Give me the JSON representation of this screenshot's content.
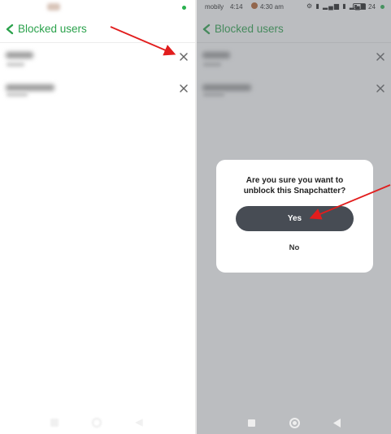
{
  "colors": {
    "accent": "#2ba24c",
    "arrow": "#e21d1d",
    "yes_button": "#474c54",
    "overlay": "#686c74"
  },
  "left_screen": {
    "header": {
      "back_icon": "chevron-left-icon",
      "title": "Blocked users"
    },
    "rows": [
      {
        "close_icon": "close-icon"
      },
      {
        "close_icon": "close-icon"
      }
    ]
  },
  "right_screen": {
    "status_bar": {
      "carrier": "mobily",
      "time": "4:14",
      "time_secondary": "4:30 am",
      "battery": "24",
      "battery_level": 0.24
    },
    "header": {
      "back_icon": "chevron-left-icon",
      "title": "Blocked users"
    },
    "rows": [
      {
        "close_icon": "close-icon"
      },
      {
        "close_icon": "close-icon"
      }
    ],
    "dialog": {
      "message": "Are you sure you want to\nunblock this Snapchatter?",
      "yes_label": "Yes",
      "no_label": "No"
    },
    "nav_icons": [
      "square-icon",
      "circle-icon",
      "triangle-back-icon"
    ]
  }
}
